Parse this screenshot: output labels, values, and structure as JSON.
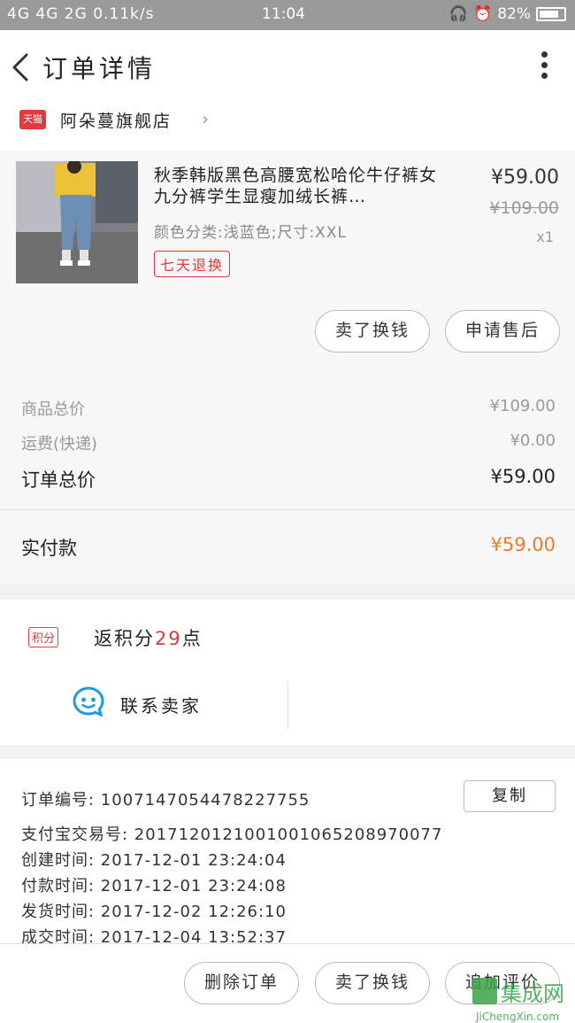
{
  "status_bar": {
    "signal": "4G 4G 2G",
    "speed": "0.11k/s",
    "time": "11:04",
    "battery": "82%",
    "battery_level": 0.82
  },
  "header": {
    "title": "订单详情"
  },
  "shop": {
    "badge": "天猫",
    "name": "阿朵蔓旗舰店"
  },
  "product": {
    "name": "秋季韩版黑色高腰宽松哈伦牛仔裤女九分裤学生显瘦加绒长裤…",
    "spec": "颜色分类:浅蓝色;尺寸:XXL",
    "badge": "七天退换",
    "price": "¥59.00",
    "original_price": "¥109.00",
    "quantity": "x1"
  },
  "product_actions": {
    "refund": "卖了换钱",
    "after_sale": "申请售后"
  },
  "summary": {
    "items_total_label": "商品总价",
    "items_total": "¥109.00",
    "shipping_label": "运费(快递)",
    "shipping": "¥0.00",
    "order_total_label": "订单总价",
    "order_total": "¥59.00",
    "paid_label": "实付款",
    "paid": "¥59.00"
  },
  "points": {
    "tag": "积分",
    "prefix": "返积分",
    "value": "29",
    "suffix": "点"
  },
  "contact": {
    "label": "联系卖家"
  },
  "order_info": {
    "copy_label": "复制",
    "order_no": "订单编号: 1007147054478227755",
    "alipay_no": "支付宝交易号: 2017120121001001065208970077",
    "created": "创建时间: 2017-12-01 23:24:04",
    "paid_time": "付款时间: 2017-12-01 23:24:08",
    "shipped": "发货时间: 2017-12-02 12:26:10",
    "completed": "成交时间: 2017-12-04 13:52:37"
  },
  "bottom_actions": {
    "delete": "删除订单",
    "sell": "卖了换钱",
    "review": "追加评价"
  },
  "watermark": {
    "text": "集成网",
    "url": "JiChengXin.com"
  }
}
